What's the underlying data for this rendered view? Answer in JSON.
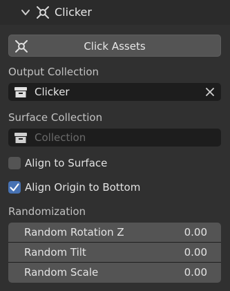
{
  "header": {
    "title": "Clicker",
    "expand_icon": "chevron-down-icon",
    "addon_icon": "crosshair-plug-icon"
  },
  "main_button": {
    "label": "Click Assets",
    "icon": "crosshair-plug-icon"
  },
  "output_collection": {
    "label": "Output Collection",
    "value": "Clicker",
    "icon": "collection-box-icon",
    "clear_icon": "close-icon"
  },
  "surface_collection": {
    "label": "Surface Collection",
    "placeholder": "Collection",
    "icon": "collection-box-icon"
  },
  "options": {
    "align_to_surface": {
      "label": "Align to Surface",
      "checked": false
    },
    "align_origin_bottom": {
      "label": "Align Origin to Bottom",
      "checked": true
    }
  },
  "randomization": {
    "label": "Randomization",
    "rows": [
      {
        "name": "Random Rotation Z",
        "value": "0.00"
      },
      {
        "name": "Random Tilt",
        "value": "0.00"
      },
      {
        "name": "Random Scale",
        "value": "0.00"
      }
    ]
  },
  "colors": {
    "panel_bg": "#303030",
    "field_bg": "#1d1d1d",
    "button_bg": "#545454",
    "accent": "#4772b3"
  }
}
